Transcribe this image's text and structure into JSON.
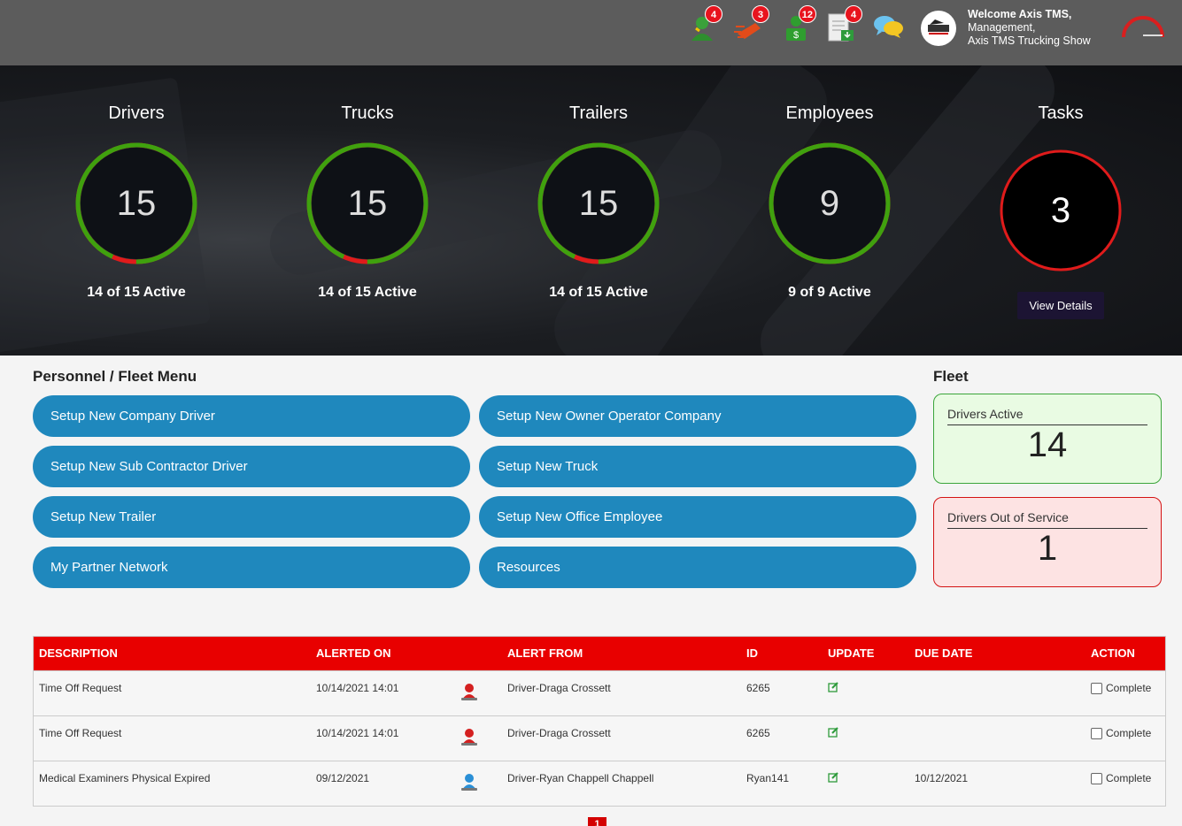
{
  "topbar": {
    "notifications": [
      {
        "name": "driver-alerts-icon",
        "count": "4",
        "color": "#3aa13a"
      },
      {
        "name": "speed-alerts-icon",
        "count": "3",
        "color": "#e24b1a"
      },
      {
        "name": "payment-alerts-icon",
        "count": "12",
        "color": "#2f9e2f"
      },
      {
        "name": "document-alerts-icon",
        "count": "4",
        "color": "#cfcfcf"
      }
    ],
    "welcome_line1": "Welcome Axis TMS,",
    "welcome_line2": "Management,",
    "welcome_line3": "Axis TMS Trucking Show"
  },
  "stats": [
    {
      "title": "Drivers",
      "value": "15",
      "sub": "14 of 15 Active",
      "active_fraction": 0.9333
    },
    {
      "title": "Trucks",
      "value": "15",
      "sub": "14 of 15 Active",
      "active_fraction": 0.9333
    },
    {
      "title": "Trailers",
      "value": "15",
      "sub": "14 of 15 Active",
      "active_fraction": 0.9333
    },
    {
      "title": "Employees",
      "value": "9",
      "sub": "9 of 9 Active",
      "active_fraction": 1.0
    },
    {
      "title": "Tasks",
      "value": "3",
      "button": "View Details"
    }
  ],
  "colors": {
    "ring_active": "#3fa10e",
    "ring_inactive": "#e01b1b",
    "table_header": "#e80000",
    "menu_button": "#1f88bd"
  },
  "menu": {
    "title": "Personnel / Fleet Menu",
    "items": [
      "Setup New Company Driver",
      "Setup New Owner Operator Company",
      "Setup New Sub Contractor Driver",
      "Setup New Truck",
      "Setup New Trailer",
      "Setup New Office Employee",
      "My Partner Network",
      "Resources"
    ]
  },
  "fleet": {
    "title": "Fleet",
    "active_label": "Drivers Active",
    "active_value": "14",
    "oos_label": "Drivers Out of Service",
    "oos_value": "1"
  },
  "table": {
    "headers": [
      "DESCRIPTION",
      "ALERTED ON",
      "ALERT FROM",
      "ID",
      "UPDATE",
      "DUE DATE",
      "ACTION"
    ],
    "rows": [
      {
        "description": "Time Off Request",
        "alerted_on": "10/14/2021 14:01",
        "icon": "person-red-icon",
        "from": "Driver-Draga Crossett",
        "id": "6265",
        "due": "",
        "action": "Complete"
      },
      {
        "description": "Time Off Request",
        "alerted_on": "10/14/2021 14:01",
        "icon": "person-red-icon",
        "from": "Driver-Draga Crossett",
        "id": "6265",
        "due": "",
        "action": "Complete"
      },
      {
        "description": "Medical Examiners Physical Expired",
        "alerted_on": "09/12/2021",
        "icon": "person-blue-icon",
        "from": "Driver-Ryan Chappell Chappell",
        "id": "Ryan141",
        "due": "10/12/2021",
        "action": "Complete"
      }
    ]
  },
  "pager": {
    "current": "1"
  }
}
